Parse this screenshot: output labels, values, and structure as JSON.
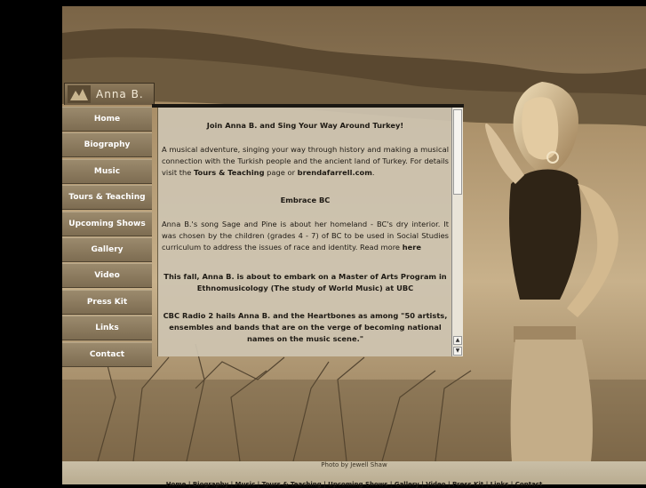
{
  "site": {
    "title": "Anna  B."
  },
  "nav": {
    "items": [
      {
        "label": "Home"
      },
      {
        "label": "Biography"
      },
      {
        "label": "Music"
      },
      {
        "label": "Tours & Teaching"
      },
      {
        "label": "Upcoming Shows"
      },
      {
        "label": "Gallery"
      },
      {
        "label": "Video"
      },
      {
        "label": "Press Kit"
      },
      {
        "label": "Links"
      },
      {
        "label": "Contact"
      }
    ]
  },
  "content": {
    "headline1": "Join Anna B. and Sing Your Way Around Turkey!",
    "para1_start": "A musical adventure, singing your way through history and making a musical connection with the Turkish people and the ancient land of Turkey. For details visit the ",
    "para1_link1": "Tours & Teaching",
    "para1_mid": " page or ",
    "para1_link2": "brendafarrell.com",
    "para1_end": ".",
    "headline2": "Embrace BC",
    "para2_start": "Anna B.'s song Sage and Pine is about her homeland - BC's dry interior. It was chosen by the children (grades 4 - 7) of BC to be used in Social Studies curriculum to address the issues of race and identity. Read more ",
    "para2_link": "here",
    "para3": "This fall, Anna B. is about to embark on a Master of Arts Program in Ethnomusicology (The study of World Music) at UBC",
    "para4": "CBC Radio 2 hails Anna B. and the Heartbones as among \"50 artists, ensembles and bands that are on the verge of becoming national names on the music scene.\""
  },
  "footer": {
    "credit": "Photo by Jewell Shaw",
    "links": "Home | Biography | Music | Tours & Teaching | Upcoming Shows | Gallery | Video | Press Kit | Links | Contact"
  },
  "scrollbar": {
    "up_glyph": "▲",
    "down_glyph": "▼"
  },
  "colors": {
    "sepia_light": "#e6d4ae",
    "sepia_dark": "#4a3a26",
    "nav_bg": "#8b7a5d"
  }
}
